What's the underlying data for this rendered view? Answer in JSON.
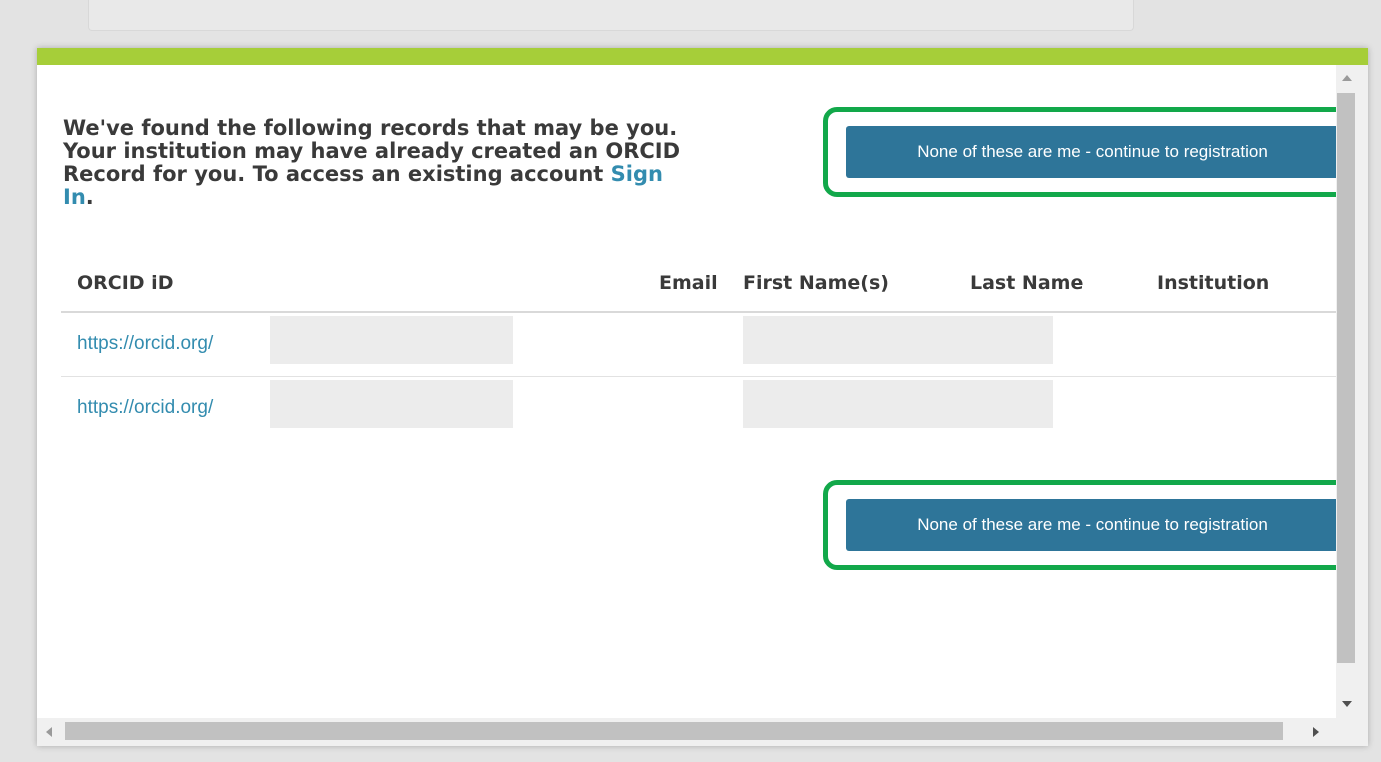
{
  "colors": {
    "accent_bar": "#a6ce39",
    "button_bg": "#2e7599",
    "link": "#338caf",
    "highlight": "#12a84a"
  },
  "intro": {
    "text": "We've found the following records that may be you. Your institution may have already created an ORCID Record for you. To access an existing account ",
    "sign_in_link": "Sign In",
    "trailing": "."
  },
  "buttons": {
    "continue_top": "None of these are me - continue to registration",
    "continue_bottom": "None of these are me - continue to registration"
  },
  "table": {
    "columns": [
      "ORCID iD",
      "Email",
      "First Name(s)",
      "Last Name",
      "Institution"
    ],
    "rows": [
      {
        "orcid_prefix": "https://orcid.org/",
        "email": "",
        "first_name": "",
        "last_name": "",
        "institution": ""
      },
      {
        "orcid_prefix": "https://orcid.org/",
        "email": "",
        "first_name": "",
        "last_name": "",
        "institution": ""
      }
    ]
  }
}
